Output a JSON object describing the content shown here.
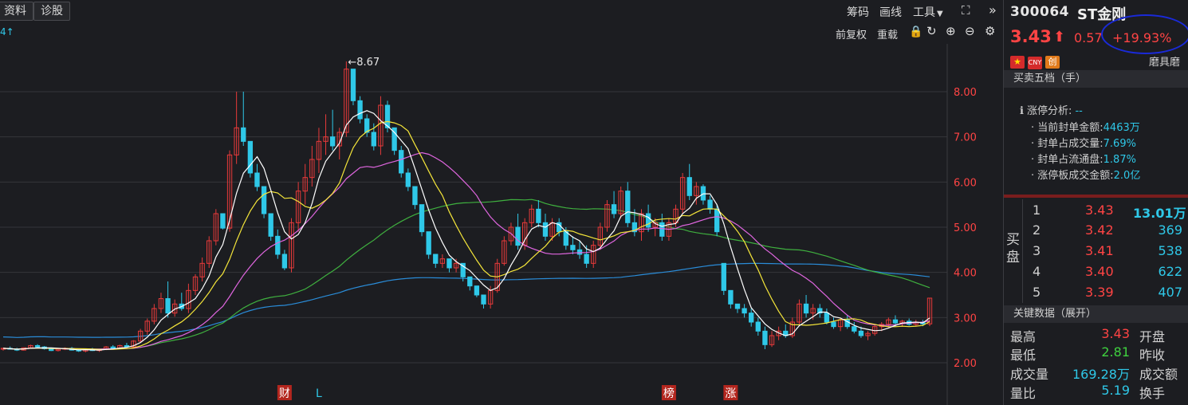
{
  "toolbar": {
    "tab_info": "资料",
    "tab_diagnose": "诊股",
    "chip": "筹码",
    "draw": "画线",
    "tools": "工具",
    "adjust_forward": "前复权",
    "reload": "重载",
    "small_indicator": "4↑"
  },
  "chart_data": {
    "type": "candlestick",
    "y_ticks": [
      "8.00",
      "7.00",
      "6.00",
      "5.00",
      "4.00",
      "3.00",
      "2.00"
    ],
    "ylim": [
      1.6,
      9.4
    ],
    "peak_label": "←8.67",
    "tags": [
      {
        "text": "财",
        "boxed": true
      },
      {
        "text": "L",
        "boxed": false
      },
      {
        "text": "榜",
        "boxed": true
      },
      {
        "text": "涨",
        "boxed": true
      }
    ],
    "ohlc": [
      [
        2.3,
        2.33,
        2.27,
        2.32
      ],
      [
        2.32,
        2.36,
        2.29,
        2.3
      ],
      [
        2.3,
        2.33,
        2.26,
        2.28
      ],
      [
        2.28,
        2.34,
        2.27,
        2.33
      ],
      [
        2.33,
        2.4,
        2.31,
        2.38
      ],
      [
        2.38,
        2.41,
        2.33,
        2.35
      ],
      [
        2.35,
        2.37,
        2.29,
        2.31
      ],
      [
        2.31,
        2.33,
        2.26,
        2.27
      ],
      [
        2.27,
        2.31,
        2.25,
        2.3
      ],
      [
        2.3,
        2.34,
        2.28,
        2.32
      ],
      [
        2.32,
        2.35,
        2.27,
        2.28
      ],
      [
        2.28,
        2.31,
        2.24,
        2.26
      ],
      [
        2.26,
        2.3,
        2.23,
        2.29
      ],
      [
        2.29,
        2.33,
        2.26,
        2.27
      ],
      [
        2.27,
        2.31,
        2.24,
        2.3
      ],
      [
        2.3,
        2.37,
        2.28,
        2.35
      ],
      [
        2.35,
        2.39,
        2.3,
        2.32
      ],
      [
        2.32,
        2.4,
        2.3,
        2.38
      ],
      [
        2.38,
        2.44,
        2.33,
        2.35
      ],
      [
        2.35,
        2.5,
        2.33,
        2.48
      ],
      [
        2.48,
        2.75,
        2.45,
        2.7
      ],
      [
        2.7,
        2.98,
        2.62,
        2.92
      ],
      [
        2.92,
        3.3,
        2.85,
        3.2
      ],
      [
        3.2,
        3.55,
        3.1,
        3.42
      ],
      [
        3.42,
        3.8,
        3.0,
        3.1
      ],
      [
        3.1,
        3.4,
        3.02,
        3.3
      ],
      [
        3.3,
        3.55,
        3.15,
        3.2
      ],
      [
        3.2,
        3.75,
        3.1,
        3.6
      ],
      [
        3.6,
        3.96,
        3.5,
        3.9
      ],
      [
        3.9,
        4.33,
        3.8,
        4.2
      ],
      [
        4.2,
        4.8,
        4.1,
        4.7
      ],
      [
        4.7,
        5.4,
        4.6,
        5.3
      ],
      [
        5.3,
        5.1,
        4.95,
        4.98
      ],
      [
        4.98,
        6.7,
        4.9,
        6.6
      ],
      [
        6.6,
        8.0,
        6.4,
        7.2
      ],
      [
        7.2,
        8.0,
        6.8,
        6.9
      ],
      [
        6.9,
        6.5,
        6.1,
        6.2
      ],
      [
        6.2,
        6.4,
        5.8,
        5.9
      ],
      [
        5.9,
        5.5,
        5.2,
        5.3
      ],
      [
        5.3,
        5.1,
        4.7,
        4.8
      ],
      [
        4.8,
        4.95,
        4.3,
        4.4
      ],
      [
        4.4,
        4.5,
        4.05,
        4.1
      ],
      [
        4.1,
        5.2,
        4.0,
        5.1
      ],
      [
        5.1,
        6.0,
        4.9,
        5.8
      ],
      [
        5.8,
        6.4,
        5.5,
        6.1
      ],
      [
        6.1,
        6.8,
        5.9,
        6.5
      ],
      [
        6.5,
        7.2,
        6.2,
        6.9
      ],
      [
        6.9,
        7.5,
        6.6,
        7.0
      ],
      [
        7.0,
        7.6,
        6.7,
        6.8
      ],
      [
        6.8,
        7.2,
        6.5,
        7.1
      ],
      [
        7.1,
        8.67,
        7.0,
        8.5
      ],
      [
        8.5,
        8.4,
        7.7,
        7.8
      ],
      [
        7.8,
        7.9,
        7.3,
        7.4
      ],
      [
        7.4,
        7.5,
        7.0,
        7.1
      ],
      [
        7.1,
        7.3,
        6.7,
        6.8
      ],
      [
        6.8,
        7.9,
        6.6,
        7.7
      ],
      [
        7.7,
        7.8,
        7.1,
        7.2
      ],
      [
        7.2,
        7.2,
        6.6,
        6.7
      ],
      [
        6.7,
        6.8,
        6.1,
        6.2
      ],
      [
        6.2,
        6.3,
        5.8,
        5.9
      ],
      [
        5.9,
        5.9,
        5.4,
        5.5
      ],
      [
        5.5,
        5.5,
        4.8,
        4.9
      ],
      [
        4.9,
        4.7,
        4.3,
        4.4
      ],
      [
        4.4,
        4.4,
        4.1,
        4.2
      ],
      [
        4.2,
        4.4,
        4.1,
        4.3
      ],
      [
        4.3,
        4.3,
        4.0,
        4.1
      ],
      [
        4.1,
        4.3,
        4.0,
        4.2
      ],
      [
        4.2,
        4.2,
        3.8,
        3.9
      ],
      [
        3.9,
        3.9,
        3.6,
        3.7
      ],
      [
        3.7,
        3.7,
        3.45,
        3.5
      ],
      [
        3.5,
        3.5,
        3.2,
        3.3
      ],
      [
        3.3,
        3.7,
        3.2,
        3.6
      ],
      [
        3.6,
        4.3,
        3.55,
        4.2
      ],
      [
        4.2,
        4.8,
        4.15,
        4.7
      ],
      [
        4.7,
        5.1,
        4.6,
        5.0
      ],
      [
        5.0,
        5.3,
        4.5,
        4.6
      ],
      [
        4.6,
        5.2,
        4.5,
        5.1
      ],
      [
        5.1,
        5.5,
        5.0,
        5.4
      ],
      [
        5.4,
        5.6,
        5.0,
        5.1
      ],
      [
        5.1,
        5.3,
        4.7,
        4.8
      ],
      [
        4.8,
        5.2,
        4.7,
        5.1
      ],
      [
        5.1,
        5.2,
        4.8,
        4.9
      ],
      [
        4.9,
        5.0,
        4.5,
        4.6
      ],
      [
        4.6,
        4.8,
        4.4,
        4.5
      ],
      [
        4.5,
        4.7,
        4.3,
        4.4
      ],
      [
        4.4,
        4.6,
        4.1,
        4.2
      ],
      [
        4.2,
        4.7,
        4.1,
        4.6
      ],
      [
        4.6,
        5.1,
        4.5,
        5.0
      ],
      [
        5.0,
        5.6,
        4.9,
        5.5
      ],
      [
        5.5,
        5.8,
        5.2,
        5.3
      ],
      [
        5.3,
        5.9,
        5.2,
        5.8
      ],
      [
        5.8,
        6.0,
        5.0,
        5.1
      ],
      [
        5.1,
        5.4,
        4.8,
        4.9
      ],
      [
        4.9,
        5.4,
        4.7,
        5.3
      ],
      [
        5.3,
        5.5,
        4.9,
        5.0
      ],
      [
        5.0,
        5.2,
        4.8,
        5.1
      ],
      [
        5.1,
        5.3,
        4.7,
        4.8
      ],
      [
        4.8,
        5.2,
        4.7,
        5.1
      ],
      [
        5.1,
        5.5,
        5.0,
        5.4
      ],
      [
        5.4,
        6.2,
        5.3,
        6.1
      ],
      [
        6.1,
        6.4,
        5.6,
        5.7
      ],
      [
        5.7,
        6.0,
        5.5,
        5.9
      ],
      [
        5.9,
        5.95,
        5.5,
        5.6
      ],
      [
        5.6,
        5.7,
        5.3,
        5.4
      ],
      [
        5.4,
        5.5,
        4.8,
        4.9
      ],
      [
        4.2,
        4.2,
        3.5,
        3.6
      ],
      [
        3.6,
        3.6,
        3.2,
        3.3
      ],
      [
        3.3,
        3.3,
        3.1,
        3.2
      ],
      [
        3.2,
        3.3,
        3.0,
        3.1
      ],
      [
        3.1,
        3.2,
        2.8,
        2.9
      ],
      [
        2.9,
        3.0,
        2.6,
        2.7
      ],
      [
        2.7,
        2.8,
        2.3,
        2.4
      ],
      [
        2.4,
        2.7,
        2.35,
        2.6
      ],
      [
        2.6,
        2.8,
        2.5,
        2.7
      ],
      [
        2.7,
        2.85,
        2.55,
        2.6
      ],
      [
        2.6,
        3.0,
        2.55,
        2.9
      ],
      [
        2.9,
        3.4,
        2.85,
        3.3
      ],
      [
        3.3,
        3.5,
        3.0,
        3.1
      ],
      [
        3.1,
        3.3,
        2.95,
        3.2
      ],
      [
        3.2,
        3.3,
        3.0,
        3.1
      ],
      [
        3.1,
        3.2,
        2.85,
        2.9
      ],
      [
        2.9,
        3.0,
        2.75,
        2.8
      ],
      [
        2.8,
        3.0,
        2.7,
        2.95
      ],
      [
        2.95,
        3.05,
        2.75,
        2.8
      ],
      [
        2.8,
        2.9,
        2.65,
        2.7
      ],
      [
        2.7,
        2.8,
        2.55,
        2.6
      ],
      [
        2.6,
        2.7,
        2.5,
        2.65
      ],
      [
        2.65,
        2.85,
        2.6,
        2.8
      ],
      [
        2.8,
        2.9,
        2.7,
        2.85
      ],
      [
        2.85,
        3.0,
        2.78,
        2.95
      ],
      [
        2.95,
        3.05,
        2.8,
        2.88
      ],
      [
        2.88,
        2.95,
        2.8,
        2.92
      ],
      [
        2.92,
        2.98,
        2.82,
        2.85
      ],
      [
        2.85,
        2.95,
        2.8,
        2.9
      ],
      [
        2.9,
        2.95,
        2.81,
        2.86
      ],
      [
        2.86,
        3.43,
        2.81,
        3.43
      ]
    ]
  },
  "right": {
    "code": "300064",
    "name": "ST金刚",
    "price": "3.43",
    "arrow": "⬆",
    "change": "0.57",
    "change_pct": "+19.93%",
    "badges": [
      "★",
      "CNY",
      "创"
    ],
    "mojo": "磨具磨",
    "orderbook_header": "买卖五档（手）",
    "zt_title": "涨停分析:",
    "zt_title_val": "--",
    "zt_items": [
      {
        "label": "当前封单金额:",
        "value": "4463万"
      },
      {
        "label": "封单占成交量:",
        "value": "7.69%"
      },
      {
        "label": "封单占流通盘:",
        "value": "1.87%"
      },
      {
        "label": "涨停板成交金额:",
        "value": "2.0亿"
      }
    ],
    "buy_side_label_1": "买",
    "buy_side_label_2": "盘",
    "bids": [
      {
        "level": "1",
        "price": "3.43",
        "volume": "13.01万"
      },
      {
        "level": "2",
        "price": "3.42",
        "volume": "369"
      },
      {
        "level": "3",
        "price": "3.41",
        "volume": "538"
      },
      {
        "level": "4",
        "price": "3.40",
        "volume": "622"
      },
      {
        "level": "5",
        "price": "3.39",
        "volume": "407"
      }
    ],
    "key_data_header": "关键数据（展开）",
    "key_data": [
      {
        "label": "最高",
        "value": "3.43",
        "color": "#ff4444",
        "label2": "开盘"
      },
      {
        "label": "最低",
        "value": "2.81",
        "color": "#3fd13f",
        "label2": "昨收"
      },
      {
        "label": "成交量",
        "value": "169.28万",
        "color": "#2fc8e8",
        "label2": "成交额"
      },
      {
        "label": "量比",
        "value": "5.19",
        "color": "#2fc8e8",
        "label2": "换手"
      }
    ]
  },
  "colors": {
    "up": "#e83a3a",
    "down": "#2fc8e8",
    "ma5": "#ffffff",
    "ma10": "#f5e63a",
    "ma20": "#e066e0",
    "ma60": "#3fb03f",
    "ma120": "#2a8cd8",
    "grid": "#34353a"
  }
}
